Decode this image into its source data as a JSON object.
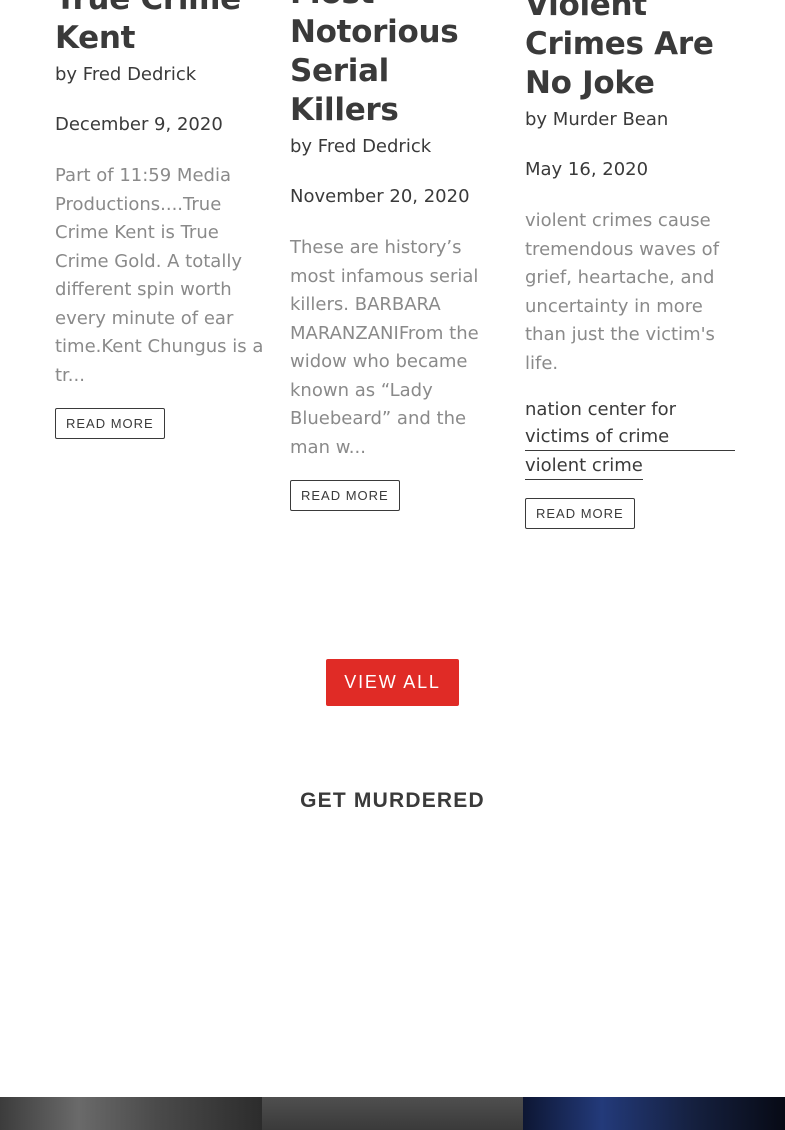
{
  "posts": [
    {
      "title_lines": [
        "True Crime",
        "Kent"
      ],
      "author": "by Fred Dedrick",
      "date": "December 9, 2020",
      "excerpt": "Part of 11:59 Media Productions....True Crime Kent is True Crime Gold. A totally different spin worth every minute of ear time.Kent Chungus is a tr...",
      "tags": [],
      "read_more": "READ MORE"
    },
    {
      "title_lines": [
        "Most",
        "Notorious",
        "Serial",
        "Killers"
      ],
      "author": "by Fred Dedrick",
      "date": "November 20, 2020",
      "excerpt": "These are history’s most infamous serial killers. BARBARA MARANZANIFrom the widow who became known as “Lady Bluebeard” and the man w...",
      "tags": [],
      "read_more": "READ MORE"
    },
    {
      "title_lines": [
        "Violent",
        "Crimes Are",
        "No Joke"
      ],
      "author": "by Murder Bean",
      "date": "May 16, 2020",
      "excerpt": "violent crimes cause tremendous waves of grief, heartache, and uncertainty in more than just the victim's life.",
      "tags": [
        "nation center for victims of crime",
        "violent crime"
      ],
      "read_more": "READ MORE"
    }
  ],
  "view_all_label": "VIEW ALL",
  "section_title": "GET MURDERED",
  "colors": {
    "accent": "#e02b26",
    "text": "#3a3a3a",
    "muted": "#8a8a8a"
  }
}
